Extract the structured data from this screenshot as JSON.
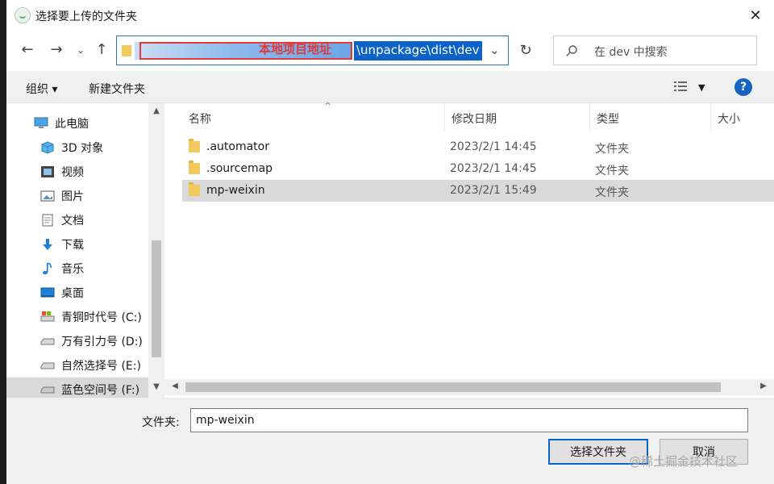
{
  "window": {
    "title": "选择要上传的文件夹",
    "close_glyph": "✕"
  },
  "address": {
    "annotation": "本地项目地址",
    "path_visible": "\\unpackage\\dist\\dev",
    "refresh_glyph": "↻"
  },
  "search": {
    "placeholder": "在 dev 中搜索"
  },
  "toolbar": {
    "organize_label": "组织 ▾",
    "new_folder_label": "新建文件夹",
    "help_label": "?"
  },
  "nav": {
    "items": [
      {
        "label": "此电脑",
        "icon": "computer-icon"
      },
      {
        "label": "3D 对象",
        "icon": "cube-icon"
      },
      {
        "label": "视频",
        "icon": "video-icon"
      },
      {
        "label": "图片",
        "icon": "picture-icon"
      },
      {
        "label": "文档",
        "icon": "document-icon"
      },
      {
        "label": "下载",
        "icon": "download-icon"
      },
      {
        "label": "音乐",
        "icon": "music-icon"
      },
      {
        "label": "桌面",
        "icon": "desktop-icon"
      },
      {
        "label": "青铜时代号 (C:)",
        "icon": "drive-icon"
      },
      {
        "label": "万有引力号 (D:)",
        "icon": "drive-icon"
      },
      {
        "label": "自然选择号 (E:)",
        "icon": "drive-icon"
      },
      {
        "label": "蓝色空间号 (F:)",
        "icon": "drive-icon"
      }
    ]
  },
  "columns": {
    "name": "名称",
    "date": "修改日期",
    "type": "类型",
    "size": "大小"
  },
  "files": [
    {
      "name": ".automator",
      "date": "2023/2/1 14:45",
      "type": "文件夹"
    },
    {
      "name": ".sourcemap",
      "date": "2023/2/1 14:45",
      "type": "文件夹"
    },
    {
      "name": "mp-weixin",
      "date": "2023/2/1 15:49",
      "type": "文件夹"
    }
  ],
  "footer": {
    "folder_label": "文件夹:",
    "folder_value": "mp-weixin",
    "select_button": "选择文件夹",
    "cancel_button": "取消",
    "watermark": "@稀土掘金技术社区"
  }
}
